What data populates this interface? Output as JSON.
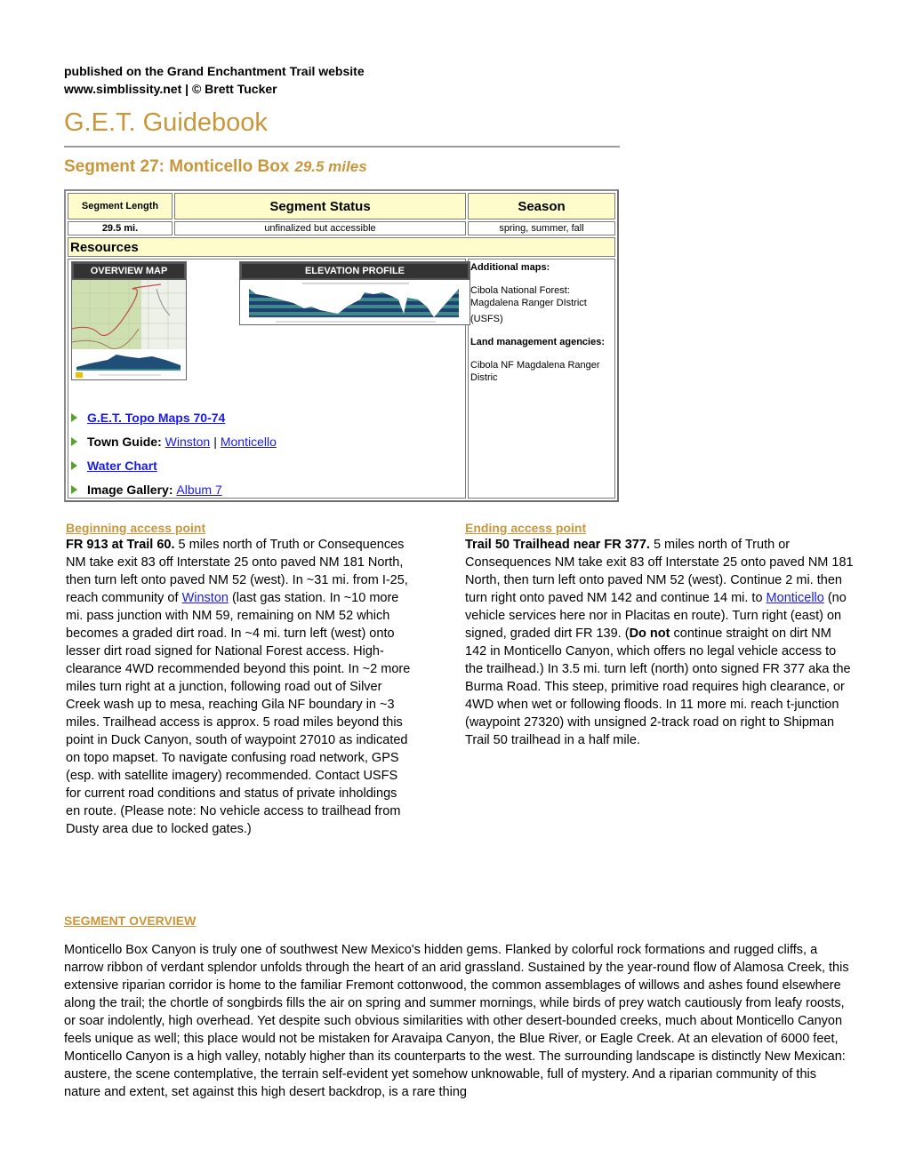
{
  "header": {
    "published_line": "published on the Grand Enchantment Trail website",
    "credit_line": "www.simblissity.net | © Brett Tucker",
    "title": "G.E.T. Guidebook",
    "segment_title": "Segment 27: Monticello Box",
    "segment_miles": "29.5 miles"
  },
  "info_table": {
    "columns": [
      "Segment Length",
      "Segment Status",
      "Season"
    ],
    "values": [
      "29.5 mi.",
      "unfinalized but accessible",
      "spring, summer, fall"
    ],
    "resources_label": "Resources",
    "overview_map_label": "OVERVIEW MAP",
    "elevation_profile_label": "ELEVATION PROFILE",
    "links": {
      "topo_maps": "G.E.T. Topo Maps 70-74",
      "town_guide_label": "Town Guide:",
      "town_1": "Winston",
      "town_sep": "|",
      "town_2": "Monticello",
      "water_chart": "Water Chart",
      "gallery_label": "Image Gallery:",
      "gallery_link": "Album 7"
    },
    "side": {
      "additional_maps_label": "Additional maps:",
      "additional_maps_text": "Cibola National Forest: Magdalena Ranger DIstrict",
      "additional_maps_agency": "(USFS)",
      "land_mgmt_label": "Land management agencies:",
      "land_mgmt_text": "Cibola NF Magdalena Ranger Distric"
    }
  },
  "beginning": {
    "heading": "Beginning access point",
    "lead": "FR 913 at Trail 60.",
    "text_1": " 5 miles north of Truth or Consequences NM take exit 83 off Interstate 25 onto paved NM 181 North, then turn left onto paved NM 52 (west). In ~31 mi. from I-25, reach community of ",
    "link": "Winston",
    "text_2": " (last gas station. In ~10 more mi. pass junction with NM 59, remaining on NM 52 which becomes a graded dirt road. In ~4 mi. turn left (west) onto lesser dirt road signed for National Forest access. High-clearance 4WD recommended beyond this point. In ~2 more miles turn right at a junction, following road out of Silver Creek wash up to mesa, reaching Gila NF boundary in ~3 miles. Trailhead access is approx. 5 road miles beyond this point in Duck Canyon, south of waypoint 27010 as indicated on topo mapset. To navigate confusing road network, GPS (esp. with satellite imagery) recommended. Contact USFS for current road conditions and status of private inholdings en route. (Please note: No vehicle access to trailhead from Dusty area due to locked gates.)"
  },
  "ending": {
    "heading": "Ending access point",
    "lead": "Trail 50 Trailhead near FR 377.",
    "text_1": " 5 miles north of Truth or Consequences NM take exit 83 off Interstate 25 onto paved NM 181 North, then turn left onto paved NM 52 (west). Continue 2 mi. then turn right onto paved NM 142 and continue 14 mi. to ",
    "link": "Monticello",
    "text_2": " (no vehicle services here nor in Placitas en route). Turn right (east) on signed, graded dirt FR 139. (",
    "bold_2": "Do not",
    "text_3": " continue straight on dirt NM 142 in Monticello Canyon, which offers no legal vehicle access to the trailhead.) In 3.5 mi. turn left (north) onto signed FR 377 aka the Burma Road. This steep, primitive road requires high clearance, or 4WD when wet or following floods. In 11 more mi. reach t-junction (waypoint 27320) with unsigned 2-track road on right to Shipman Trail 50 trailhead in a half mile."
  },
  "overview": {
    "heading": "SEGMENT OVERVIEW",
    "text": "Monticello Box Canyon is truly one of southwest New Mexico's hidden gems. Flanked by colorful rock formations and rugged cliffs, a narrow ribbon of verdant splendor unfolds through the heart of an arid grassland. Sustained by the year-round flow of Alamosa Creek, this extensive riparian corridor is home to the familiar Fremont cottonwood, the common assemblages of willows and ashes found elsewhere along the trail; the chortle of songbirds fills the air on spring and summer mornings, while birds of prey watch cautiously from leafy roosts, or soar indolently, high overhead. Yet despite such obvious similarities with other desert-bounded creeks, much about Monticello Canyon feels unique as well; this place would not be mistaken for Aravaipa Canyon, the Blue River, or Eagle Creek. At an elevation of 6000 feet, Monticello Canyon is a high valley, notably higher than its counterparts to the west. The surrounding landscape is distinctly New Mexican: austere, the scene contemplative, the terrain self-evident yet somehow unknowable, full of mystery. And a riparian community of this nature and extent, set against this high desert backdrop, is a rare thing"
  },
  "colors": {
    "accent_gold": "#c9973a",
    "table_header_bg": "#fffccc",
    "link_blue": "#1a1aee",
    "bullet_green": "#5aa02c"
  }
}
